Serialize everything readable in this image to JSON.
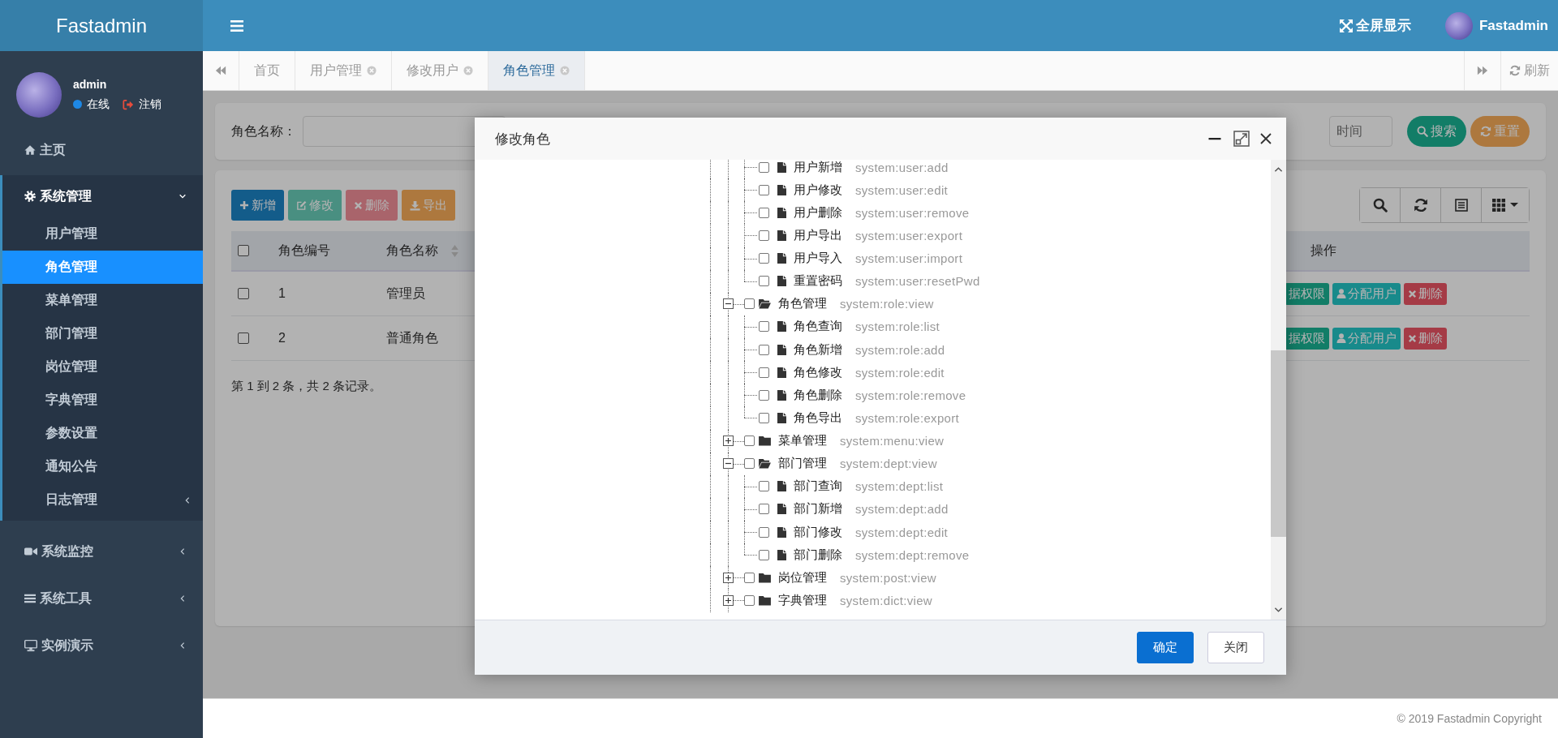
{
  "topbar": {
    "brand": "Fastadmin",
    "fullscreen": "全屏显示",
    "user": "Fastadmin"
  },
  "user_panel": {
    "name": "admin",
    "status": "在线",
    "logout": "注销"
  },
  "sidebar": {
    "items": [
      {
        "label": "主页",
        "selected": false
      },
      {
        "label": "系统管理",
        "selected": false,
        "expanded": true,
        "children": [
          {
            "label": "用户管理",
            "selected": false
          },
          {
            "label": "角色管理",
            "selected": true
          },
          {
            "label": "菜单管理",
            "selected": false
          },
          {
            "label": "部门管理",
            "selected": false
          },
          {
            "label": "岗位管理",
            "selected": false
          },
          {
            "label": "字典管理",
            "selected": false
          },
          {
            "label": "参数设置",
            "selected": false
          },
          {
            "label": "通知公告",
            "selected": false
          },
          {
            "label": "日志管理",
            "selected": false,
            "expanded": false
          }
        ]
      },
      {
        "label": "系统监控",
        "selected": false,
        "expanded": false
      },
      {
        "label": "系统工具",
        "selected": false,
        "expanded": false
      },
      {
        "label": "实例演示",
        "selected": false,
        "expanded": false
      }
    ]
  },
  "tabs": {
    "items": [
      {
        "label": "首页",
        "selected": false,
        "closable": false
      },
      {
        "label": "用户管理",
        "selected": false,
        "closable": true
      },
      {
        "label": "修改用户",
        "selected": false,
        "closable": true
      },
      {
        "label": "角色管理",
        "selected": true,
        "closable": true
      }
    ],
    "refresh": "刷新"
  },
  "search_form": {
    "field_label": "角色名称：",
    "time_placeholder": "时间",
    "search_button": "搜索",
    "reset_button": "重置"
  },
  "toolbar": {
    "buttons": [
      {
        "label": "新增",
        "kind": "primary",
        "disabled": false
      },
      {
        "label": "修改",
        "kind": "success",
        "disabled": true
      },
      {
        "label": "删除",
        "kind": "danger",
        "disabled": true
      },
      {
        "label": "导出",
        "kind": "warning",
        "disabled": false
      }
    ]
  },
  "table": {
    "header_checked": false,
    "columns": [
      {
        "label": "角色编号",
        "sortable": false
      },
      {
        "label": "角色名称",
        "sortable": true
      },
      {
        "label": "操作",
        "sortable": false
      }
    ],
    "rows": [
      {
        "checked": false,
        "cells": [
          "1",
          "管理员"
        ],
        "actions": [
          {
            "label": "据权限",
            "kind": "data"
          },
          {
            "label": "分配用户",
            "kind": "assign"
          },
          {
            "label": "删除",
            "kind": "delete"
          }
        ]
      },
      {
        "checked": false,
        "cells": [
          "2",
          "普通角色"
        ],
        "actions": [
          {
            "label": "据权限",
            "kind": "data"
          },
          {
            "label": "分配用户",
            "kind": "assign"
          },
          {
            "label": "删除",
            "kind": "delete"
          }
        ]
      }
    ],
    "pagination": "第 1 到 2 条，共 2 条记录。"
  },
  "dialog": {
    "title": "修改角色",
    "tree": {
      "continued_children": [
        {
          "label": "用户新增",
          "perm": "system:user:add",
          "checked": false
        },
        {
          "label": "用户修改",
          "perm": "system:user:edit",
          "checked": false
        },
        {
          "label": "用户删除",
          "perm": "system:user:remove",
          "checked": false
        },
        {
          "label": "用户导出",
          "perm": "system:user:export",
          "checked": false
        },
        {
          "label": "用户导入",
          "perm": "system:user:import",
          "checked": false
        },
        {
          "label": "重置密码",
          "perm": "system:user:resetPwd",
          "checked": false
        }
      ],
      "nodes": [
        {
          "label": "角色管理",
          "perm": "system:role:view",
          "checked": false,
          "expanded": true,
          "children": [
            {
              "label": "角色查询",
              "perm": "system:role:list",
              "checked": false
            },
            {
              "label": "角色新增",
              "perm": "system:role:add",
              "checked": false
            },
            {
              "label": "角色修改",
              "perm": "system:role:edit",
              "checked": false
            },
            {
              "label": "角色删除",
              "perm": "system:role:remove",
              "checked": false
            },
            {
              "label": "角色导出",
              "perm": "system:role:export",
              "checked": false
            }
          ]
        },
        {
          "label": "菜单管理",
          "perm": "system:menu:view",
          "checked": false,
          "expanded": false
        },
        {
          "label": "部门管理",
          "perm": "system:dept:view",
          "checked": false,
          "expanded": true,
          "children": [
            {
              "label": "部门查询",
              "perm": "system:dept:list",
              "checked": false
            },
            {
              "label": "部门新增",
              "perm": "system:dept:add",
              "checked": false
            },
            {
              "label": "部门修改",
              "perm": "system:dept:edit",
              "checked": false
            },
            {
              "label": "部门删除",
              "perm": "system:dept:remove",
              "checked": false
            }
          ]
        },
        {
          "label": "岗位管理",
          "perm": "system:post:view",
          "checked": false,
          "expanded": false
        },
        {
          "label": "字典管理",
          "perm": "system:dict:view",
          "checked": false,
          "expanded": false
        }
      ]
    },
    "buttons": [
      {
        "label": "确定",
        "kind": "primary"
      },
      {
        "label": "关闭",
        "kind": "default"
      }
    ]
  },
  "footer": "© 2019 Fastadmin Copyright"
}
